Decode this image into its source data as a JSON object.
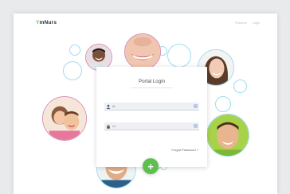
{
  "brand": {
    "logo_prefix": "Y",
    "logo_text": "mNurs",
    "accent": "#6cc04a"
  },
  "nav": {
    "links": [
      "Features",
      "Login"
    ]
  },
  "login": {
    "title": "Portal Login",
    "username_text": "Id",
    "password_text": "•••",
    "forgot_label": "Forgot Password ?",
    "submit_label": "+"
  },
  "icons": {
    "user": "user-icon",
    "lock": "lock-icon",
    "submit": "plus-icon"
  },
  "colors": {
    "bubble": "#9fdcf0",
    "submit": "#5ebf4f"
  }
}
